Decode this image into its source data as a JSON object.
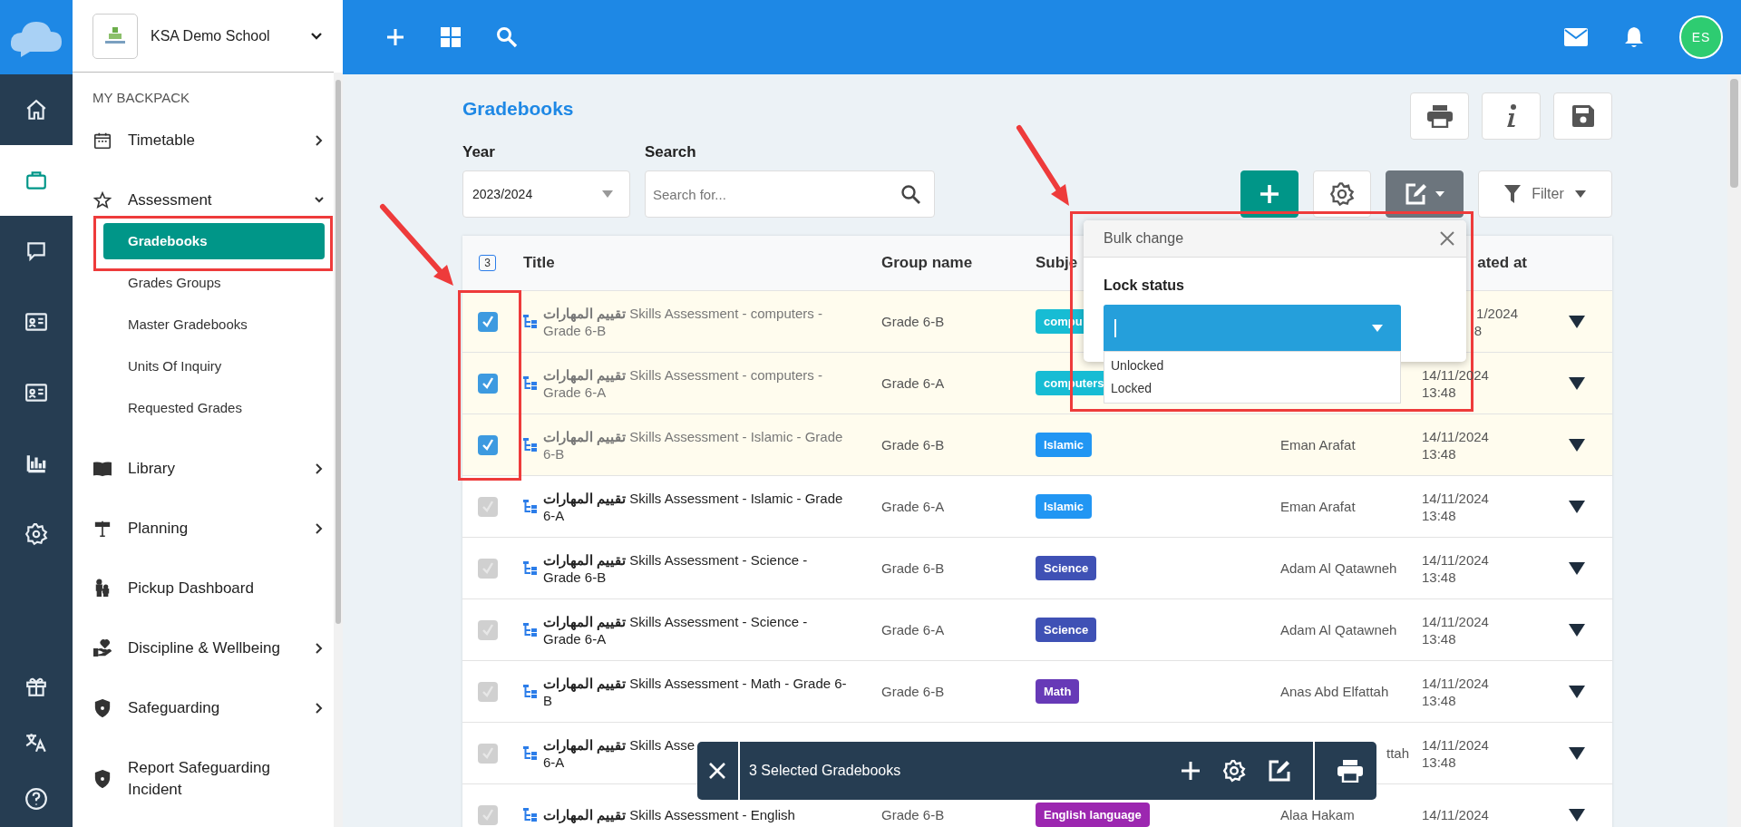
{
  "rail": {
    "items": [
      {
        "kind": "home",
        "selected": false
      },
      {
        "kind": "briefcase",
        "selected": true
      },
      {
        "kind": "chat",
        "selected": false
      },
      {
        "kind": "card",
        "selected": false
      },
      {
        "kind": "card",
        "selected": false
      },
      {
        "kind": "chart",
        "selected": false
      },
      {
        "kind": "gear",
        "selected": false
      }
    ],
    "bottom_items": [
      {
        "kind": "gift",
        "selected": false
      },
      {
        "kind": "translate",
        "selected": false
      },
      {
        "kind": "help",
        "selected": false
      }
    ]
  },
  "school": {
    "name": "KSA Demo School"
  },
  "sidebar": {
    "section": "MY BACKPACK",
    "items": [
      {
        "label": "Timetable",
        "kind": "calendar",
        "expandable": true,
        "expanded": false
      },
      {
        "label": "Assessment",
        "kind": "star",
        "expandable": true,
        "expanded": true,
        "children": [
          {
            "label": "Gradebooks",
            "selected": true
          },
          {
            "label": "Grades Groups",
            "selected": false
          },
          {
            "label": "Master Gradebooks",
            "selected": false
          },
          {
            "label": "Units Of Inquiry",
            "selected": false
          },
          {
            "label": "Requested Grades",
            "selected": false
          }
        ]
      },
      {
        "label": "Library",
        "kind": "book",
        "expandable": true,
        "expanded": false
      },
      {
        "label": "Planning",
        "kind": "signpost",
        "expandable": true,
        "expanded": false
      },
      {
        "label": "Pickup Dashboard",
        "kind": "family",
        "expandable": false,
        "expanded": false
      },
      {
        "label": "Discipline & Wellbeing",
        "kind": "heart-hand",
        "expandable": true,
        "expanded": false
      },
      {
        "label": "Safeguarding",
        "kind": "shield",
        "expandable": true,
        "expanded": false
      },
      {
        "label": "Report Safeguarding Incident",
        "kind": "shield",
        "expandable": false,
        "expanded": false
      }
    ]
  },
  "topbar": {
    "avatar": "ES"
  },
  "page": {
    "title": "Gradebooks",
    "year": {
      "label": "Year",
      "value": "2023/2024"
    },
    "search": {
      "label": "Search",
      "placeholder": "Search for..."
    },
    "filter_label": "Filter"
  },
  "table": {
    "selected_count": "3",
    "headers": {
      "title": "Title",
      "group": "Group name",
      "subject": "Subje",
      "date": {
        "text": "ated at",
        "covered": true
      }
    },
    "rows": [
      {
        "selected": true,
        "title": "**تقييم المهارات** Skills Assessment - computers - Grade 6-B",
        "group": "Grade 6-B",
        "subject": {
          "text": "compu",
          "color": "#17bcd4"
        },
        "date": {
          "text": "1/2024",
          "covered": true
        },
        "time": {
          "text": "8",
          "covered": true
        }
      },
      {
        "selected": true,
        "title": "**تقييم المهارات** Skills Assessment - computers - Grade 6-A",
        "group": "Grade 6-A",
        "subject": {
          "text": "computers",
          "color": "#17bcd4"
        },
        "date": {
          "text": "14/11/2024",
          "covered": false
        },
        "time": {
          "text": "13:48",
          "covered": false
        }
      },
      {
        "selected": true,
        "title": "**تقييم المهارات** Skills Assessment - Islamic - Grade 6-B",
        "group": "Grade 6-B",
        "subject": {
          "text": "Islamic",
          "color": "#2196f3"
        },
        "teacher": {
          "text": "Eman Arafat",
          "covered": false
        },
        "date": {
          "text": "14/11/2024",
          "covered": false
        },
        "time": {
          "text": "13:48",
          "covered": false
        }
      },
      {
        "selected": false,
        "title": "**تقييم المهارات** Skills Assessment - Islamic - Grade 6-A",
        "group": "Grade 6-A",
        "subject": {
          "text": "Islamic",
          "color": "#2196f3"
        },
        "teacher": {
          "text": "Eman Arafat",
          "covered": false
        },
        "date": {
          "text": "14/11/2024",
          "covered": false
        },
        "time": {
          "text": "13:48",
          "covered": false
        }
      },
      {
        "selected": false,
        "title": "**تقييم المهارات** Skills Assessment - Science - Grade 6-B",
        "group": "Grade 6-B",
        "subject": {
          "text": "Science",
          "color": "#3f51b5"
        },
        "teacher": {
          "text": "Adam Al Qatawneh",
          "covered": false
        },
        "date": {
          "text": "14/11/2024",
          "covered": false
        },
        "time": {
          "text": "13:48",
          "covered": false
        }
      },
      {
        "selected": false,
        "title": "**تقييم المهارات** Skills Assessment - Science - Grade 6-A",
        "group": "Grade 6-A",
        "subject": {
          "text": "Science",
          "color": "#3f51b5"
        },
        "teacher": {
          "text": "Adam Al Qatawneh",
          "covered": false
        },
        "date": {
          "text": "14/11/2024",
          "covered": false
        },
        "time": {
          "text": "13:48",
          "covered": false
        }
      },
      {
        "selected": false,
        "title": "**تقييم المهارات** Skills Assessment - Math - Grade 6-B",
        "group": "Grade 6-B",
        "subject": {
          "text": "Math",
          "color": "#673ab7"
        },
        "teacher": {
          "text": "Anas Abd Elfattah",
          "covered": false
        },
        "date": {
          "text": "14/11/2024",
          "covered": false
        },
        "time": {
          "text": "13:48",
          "covered": false
        }
      },
      {
        "selected": false,
        "title": "**تقييم المهارات** Skills Asse",
        "title_end": "6-A",
        "teacher": {
          "text": "ttah",
          "covered": true
        },
        "date": {
          "text": "14/11/2024",
          "covered": false
        },
        "time": {
          "text": "13:48",
          "covered": false
        }
      },
      {
        "selected": false,
        "title": "**تقييم المهارات** Skills Assessment - English",
        "group": "Grade 6-B",
        "subject": {
          "text": "English language",
          "color": "#9c27b0"
        },
        "teacher": {
          "text": "Alaa Hakam",
          "covered": false
        },
        "date": {
          "text": "14/11/2024",
          "covered": false
        }
      }
    ]
  },
  "bulk_change": {
    "title": "Bulk change",
    "field_label": "Lock status",
    "options": [
      {
        "label": "Unlocked",
        "selected": false
      },
      {
        "label": "Locked",
        "selected": false
      }
    ]
  },
  "selection_bar": {
    "text": "3 Selected Gradebooks"
  }
}
